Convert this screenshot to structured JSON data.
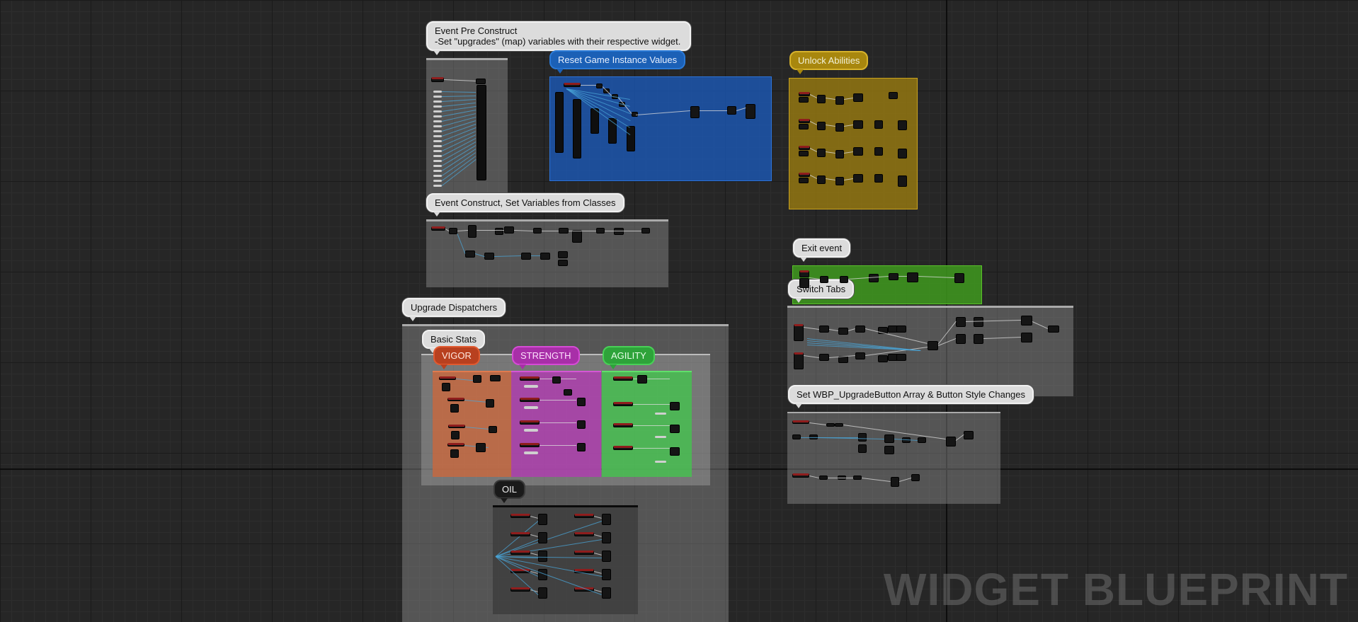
{
  "editor": {
    "mode_label": "WIDGET BLUEPRINT"
  },
  "comments": {
    "event_pre_construct": {
      "line1": "Event Pre Construct",
      "line2": "-Set \"upgrades\" (map) variables with their respective widget."
    },
    "reset_game_instance": {
      "label": "Reset Game Instance Values"
    },
    "unlock_abilities": {
      "label": "Unlock Abilities"
    },
    "event_construct": {
      "label": "Event Construct, Set Variables from Classes"
    },
    "exit_event": {
      "label": "Exit event"
    },
    "switch_tabs": {
      "label": "Switch Tabs"
    },
    "upgrade_dispatchers": {
      "label": "Upgrade Dispatchers"
    },
    "basic_stats": {
      "label": "Basic Stats"
    },
    "vigor": {
      "label": "VIGOR"
    },
    "strength": {
      "label": "STRENGTH"
    },
    "agility": {
      "label": "AGILITY"
    },
    "oil": {
      "label": "OIL"
    },
    "set_upgrade_button": {
      "label": "Set WBP_UpgradeButton Array & Button Style Changes"
    }
  },
  "colors": {
    "blue_group": "#1b5cc0",
    "gold_group": "#9c7d10",
    "green_group": "#3f9a1e",
    "vigor": "#c8693f",
    "strength": "#b03db0",
    "agility": "#45c24f",
    "event_header": "#8f1d1d",
    "exec_wire": "#dedede",
    "data_wire": "#4aa6d8"
  }
}
